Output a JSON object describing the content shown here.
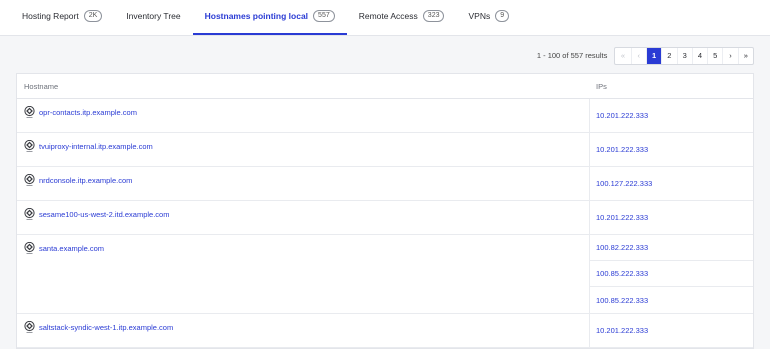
{
  "tabs": [
    {
      "label": "Hosting Report",
      "count": "2K",
      "active": false
    },
    {
      "label": "Inventory Tree",
      "count": null,
      "active": false
    },
    {
      "label": "Hostnames pointing local",
      "count": "557",
      "active": true
    },
    {
      "label": "Remote Access",
      "count": "323",
      "active": false
    },
    {
      "label": "VPNs",
      "count": "9",
      "active": false
    }
  ],
  "pagination": {
    "results": "1 - 100 of 557 results",
    "first": "«",
    "prev": "‹",
    "pages": [
      "1",
      "2",
      "3",
      "4",
      "5"
    ],
    "current": "1",
    "next": "›",
    "last": "»"
  },
  "table": {
    "columns": [
      "Hostname",
      "IPs"
    ],
    "rows": [
      {
        "hostname": "opr-contacts.itp.example.com",
        "ips": [
          "10.201.222.333"
        ]
      },
      {
        "hostname": "tvuiproxy-internal.itp.example.com",
        "ips": [
          "10.201.222.333"
        ]
      },
      {
        "hostname": "nrdconsole.itp.example.com",
        "ips": [
          "100.127.222.333"
        ]
      },
      {
        "hostname": "sesame100-us-west-2.itd.example.com",
        "ips": [
          "10.201.222.333"
        ]
      },
      {
        "hostname": "santa.example.com",
        "ips": [
          "100.82.222.333",
          "100.85.222.333",
          "100.85.222.333"
        ]
      },
      {
        "hostname": "saltstack-syndic-west-1.itp.example.com",
        "ips": [
          "10.201.222.333"
        ]
      }
    ]
  },
  "icons": {
    "host_logo": "netflix-badge-icon"
  },
  "colors": {
    "accent": "#2a3bd4",
    "background": "#f5f6f8"
  }
}
